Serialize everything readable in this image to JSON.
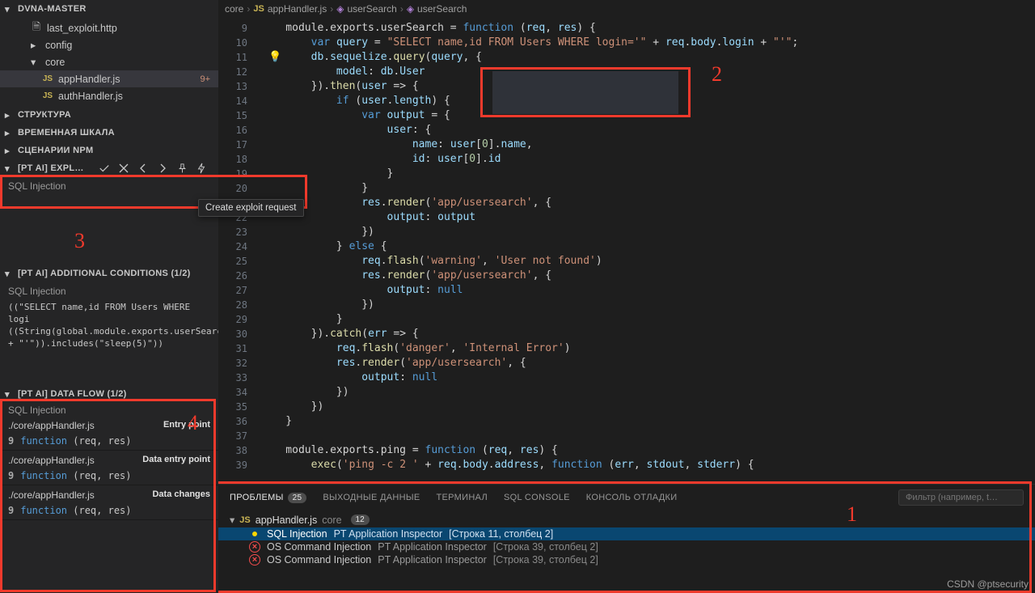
{
  "breadcrumb": {
    "seg1": "core",
    "seg2": "appHandler.js",
    "seg3": "userSearch",
    "seg4": "userSearch"
  },
  "explorer": {
    "title": "DVNA-MASTER",
    "items": [
      {
        "label": "last_exploit.http",
        "type": "file"
      },
      {
        "label": "config",
        "type": "folder",
        "open": false
      },
      {
        "label": "core",
        "type": "folder",
        "open": true
      },
      {
        "label": "appHandler.js",
        "type": "js",
        "active": true,
        "badge": "9+"
      },
      {
        "label": "authHandler.js",
        "type": "js"
      }
    ],
    "sections": [
      "СТРУКТУРА",
      "ВРЕМЕННАЯ ШКАЛА",
      "СЦЕНАРИИ NPM"
    ]
  },
  "ptai_expl": {
    "title": "[PT AI] EXPL…",
    "sub": "SQL Injection",
    "tooltip": "Create exploit request"
  },
  "ptai_cond": {
    "title": "[PT AI] ADDITIONAL CONDITIONS (1/2)",
    "sub": "SQL Injection",
    "lines": [
      "((\"SELECT name,id FROM Users WHERE logi",
      "((String(global.module.exports.userSearch.a",
      "+ \"'\")).includes(\"sleep(5)\"))"
    ]
  },
  "ptai_df": {
    "title": "[PT AI] DATA FLOW (1/2)",
    "sub": "SQL Injection",
    "entries": [
      {
        "file": "./core/appHandler.js",
        "label": "Entry point",
        "line": "9",
        "code": "function (req, res)"
      },
      {
        "file": "./core/appHandler.js",
        "label": "Data entry point",
        "line": "9",
        "code": "function (req, res)"
      },
      {
        "file": "./core/appHandler.js",
        "label": "Data changes",
        "line": "9",
        "code": "function (req, res)"
      }
    ]
  },
  "code": {
    "start": 9,
    "lines": [
      "    module.exports.userSearch = |k|function|/k| (|c|req|/c|, |c|res|/c|) {",
      "        |k|var|/k| |c|query|/c| = |s|\"SELECT name,id FROM Users WHERE login='\"|/s| + |c|req|/c|.|c|body|/c|.|c|login|/c| + |s|\"'\"|/s|;",
      "        |c|db|/c|.|c|sequelize|/c|.|fn|query|/fn|(|c|query|/c|, {",
      "            |c|model|/c|: |c|db|/c|.|c|User|/c|",
      "        }).|fn|then|/fn|(|c|user|/c| => {",
      "            |k|if|/k| (|c|user|/c|.|c|length|/c|) {",
      "                |k|var|/k| |c|output|/c| = {",
      "                    |c|user|/c|: {",
      "                        |c|name|/c|: |c|user|/c|[|n|0|/n|].|c|name|/c|,",
      "                        |c|id|/c|: |c|user|/c|[|n|0|/n|].|c|id|/c|",
      "                    }",
      "                }",
      "                |c|res|/c|.|fn|render|/fn|(|s|'app/usersearch'|/s|, {",
      "                    |c|output|/c|: |c|output|/c|",
      "                })",
      "            } |k|else|/k| {",
      "                |c|req|/c|.|fn|flash|/fn|(|s|'warning'|/s|, |s|'User not found'|/s|)",
      "                |c|res|/c|.|fn|render|/fn|(|s|'app/usersearch'|/s|, {",
      "                    |c|output|/c|: |k|null|/k|",
      "                })",
      "            }",
      "        }).|fn|catch|/fn|(|c|err|/c| => {",
      "            |c|req|/c|.|fn|flash|/fn|(|s|'danger'|/s|, |s|'Internal Error'|/s|)",
      "            |c|res|/c|.|fn|render|/fn|(|s|'app/usersearch'|/s|, {",
      "                |c|output|/c|: |k|null|/k|",
      "            })",
      "        })",
      "    }",
      "",
      "    module.exports.ping = |k|function|/k| (|c|req|/c|, |c|res|/c|) {",
      "        |fn|exec|/fn|(|s|'ping -c 2 '|/s| + |c|req|/c|.|c|body|/c|.|c|address|/c|, |k|function|/k| (|c|err|/c|, |c|stdout|/c|, |c|stderr|/c|) {"
    ]
  },
  "panel": {
    "tabs": [
      "ПРОБЛЕМЫ",
      "ВЫХОДНЫЕ ДАННЫЕ",
      "ТЕРМИНАЛ",
      "SQL CONSOLE",
      "КОНСОЛЬ ОТЛАДКИ"
    ],
    "filter_placeholder": "Фильтр (например, t…",
    "total_badge": "25",
    "file": {
      "name": "appHandler.js",
      "folder": "core",
      "count": "12"
    },
    "rows": [
      {
        "sev": "warn",
        "title": "SQL Injection",
        "src": "PT Application Inspector",
        "loc": "[Строка 11, столбец 2]",
        "selected": true
      },
      {
        "sev": "err",
        "title": "OS Command Injection",
        "src": "PT Application Inspector",
        "loc": "[Строка 39, столбец 2]"
      },
      {
        "sev": "err",
        "title": "OS Command Injection",
        "src": "PT Application Inspector",
        "loc": "[Строка 39, столбец 2]"
      }
    ]
  },
  "annotations": {
    "a1": "1",
    "a2": "2",
    "a3": "3",
    "a4": "4"
  },
  "watermark": "CSDN @ptsecurity"
}
